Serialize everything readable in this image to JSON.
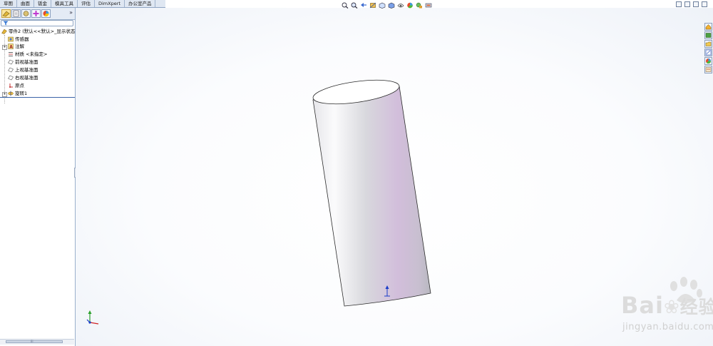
{
  "command_tabs": [
    "草图",
    "曲面",
    "钣金",
    "模具工具",
    "评估",
    "DimXpert",
    "办公室产品"
  ],
  "feature_tree": {
    "part": "零件2 (默认<<默认>_显示状态",
    "items": [
      {
        "label": "传感器",
        "icon": "sensor-icon"
      },
      {
        "label": "注解",
        "icon": "annotation-icon"
      },
      {
        "label": "材质 <未指定>",
        "icon": "material-icon"
      },
      {
        "label": "前视基准面",
        "icon": "plane-icon"
      },
      {
        "label": "上视基准面",
        "icon": "plane-icon"
      },
      {
        "label": "右视基准面",
        "icon": "plane-icon"
      },
      {
        "label": "原点",
        "icon": "origin-icon"
      },
      {
        "label": "旋转1",
        "icon": "revolve-icon"
      }
    ],
    "more_glyph": "»",
    "expander_glyph": "+"
  },
  "scroll_glyph": "III",
  "watermark": {
    "brand": "Bai",
    "brand_tail": "经验",
    "url": "jingyan.baidu.com"
  },
  "colors": {
    "cylinder_light": "#f6f6f8",
    "cylinder_mid": "#c9c9cf",
    "cylinder_tint": "#cdb8d4",
    "tab_bg": "#dfe7f2",
    "selection_blue": "#3b64a8"
  }
}
